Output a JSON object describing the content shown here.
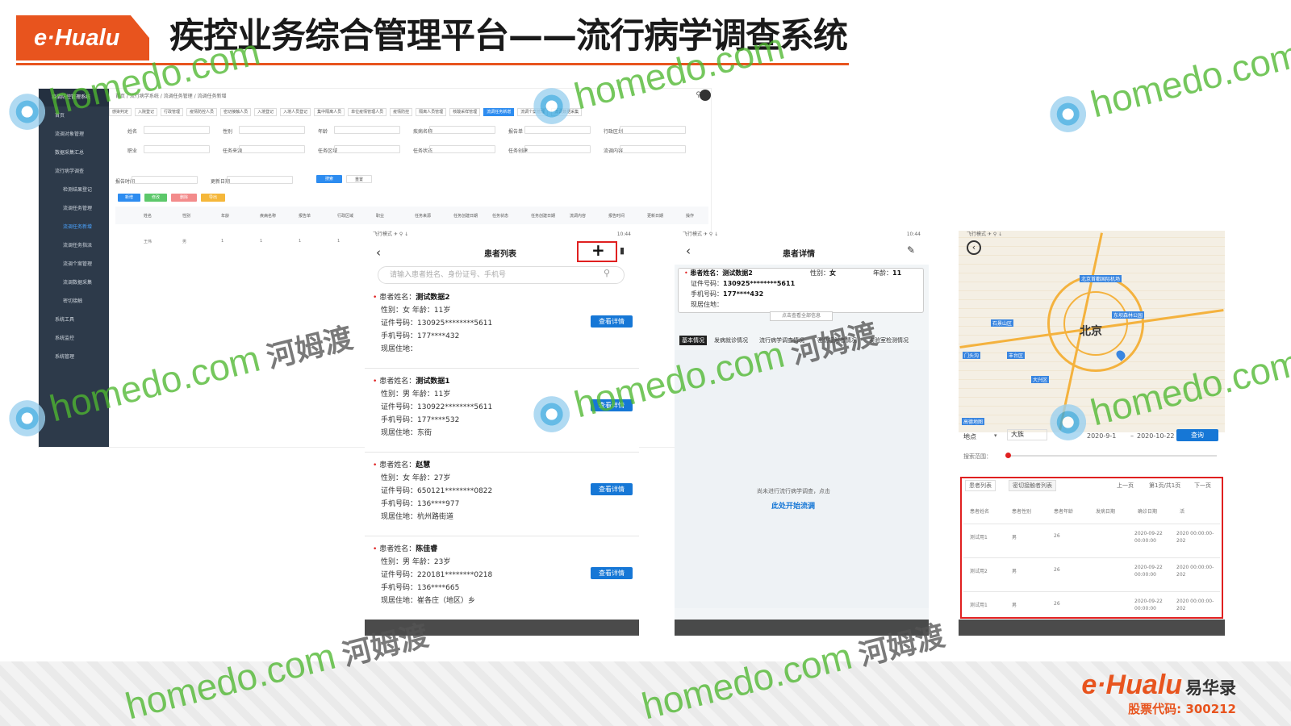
{
  "header": {
    "logo": "e·Hualu",
    "title": "疾控业务综合管理平台——流行病学调查系统"
  },
  "footer": {
    "brand": "e·Hualu",
    "brand_cn": "易华录",
    "stock": "股票代码: 300212"
  },
  "watermark": {
    "text": "homedo.com",
    "cn": "河姆渡"
  },
  "admin": {
    "brand": "疫情防控管理系统",
    "breadcrumb": "首页 / 流行病学系统 / 流调任务管理 / 流调任务新增",
    "sidebar": [
      "首页",
      "流调对象管理",
      "数据采集汇总",
      "流行病学调查",
      "检测结果登记",
      "流调任务管理",
      "流调任务新增",
      "流调任务指派",
      "流调个案管理",
      "流调数据采集",
      "密切接触",
      "系统工具",
      "系统监控",
      "系统管理"
    ],
    "tabs": [
      "感染判定",
      "入院登记",
      "行政管理",
      "疫情防控人员",
      "密切接触人员",
      "入境登记",
      "入境人员登记",
      "集中隔离人员",
      "单位疫情管理人员",
      "疫情防控",
      "隔离人员管理",
      "核酸采样管理",
      "流调任务新增",
      "流调个案管理",
      "流调数据采集"
    ],
    "filters": [
      "姓名",
      "性别",
      "年龄",
      "疾病名称",
      "报告单",
      "行政区划",
      "职业",
      "任务来源",
      "任务区域",
      "任务状态",
      "任务创建",
      "流调内容",
      "报告时间",
      "更新日期"
    ],
    "buttons": {
      "search": "搜索",
      "reset": "重置",
      "add": "新增",
      "edit": "修改",
      "del": "删除",
      "export": "导出"
    },
    "table_headers": [
      "姓名",
      "性别",
      "年龄",
      "疾病名称",
      "报告单",
      "行政区域",
      "职业",
      "任务来源",
      "任务创建日期",
      "任务状态",
      "任务创建日期",
      "流调内容",
      "报告时间",
      "更新日期",
      "操作"
    ],
    "row": [
      "王伟",
      "男",
      "1",
      "1",
      "1",
      "1",
      "1"
    ]
  },
  "phone1": {
    "status": "飞行模式 ✈ ⚲ ↓",
    "time": "10:44",
    "title": "患者列表",
    "search_placeholder": "请输入患者姓名、身份证号、手机号",
    "labels": {
      "name": "患者姓名：",
      "sex": "性别：",
      "age": "年龄：",
      "id": "证件号码：",
      "phone": "手机号码：",
      "addr": "现居住地："
    },
    "detail_label": "查看详情",
    "patients": [
      {
        "name": "测试数据2",
        "sex": "女",
        "age": "11岁",
        "id": "130925********5611",
        "phone": "177****432",
        "addr": ""
      },
      {
        "name": "测试数据1",
        "sex": "男",
        "age": "11岁",
        "id": "130922********5611",
        "phone": "177****532",
        "addr": "东街"
      },
      {
        "name": "赵慧",
        "sex": "女",
        "age": "27岁",
        "id": "650121********0822",
        "phone": "136****977",
        "addr": "杭州路街道"
      },
      {
        "name": "陈佳睿",
        "sex": "男",
        "age": "23岁",
        "id": "220181********0218",
        "phone": "136****665",
        "addr": "崔各庄（地区）乡"
      }
    ]
  },
  "phone2": {
    "status": "飞行模式 ✈ ⚲ ↓",
    "time": "10:44",
    "title": "患者详情",
    "name_label": "患者姓名：",
    "name": "测试数据2",
    "sex_label": "性别：",
    "sex": "女",
    "age_label": "年龄：",
    "age": "11",
    "id_label": "证件号码：",
    "id": "130925********5611",
    "phone_label": "手机号码：",
    "phone": "177****432",
    "addr_label": "现居住地：",
    "view_all": "点击查看全部信息",
    "tabs": [
      "基本情况",
      "发病就诊情况",
      "流行病学调查情况",
      "密切接触者情况",
      "实验室检测情况"
    ],
    "empty_hint": "尚未进行流行病学调查，点击",
    "start_link": "此处开始流调",
    "page": "1"
  },
  "phone3": {
    "status": "飞行模式 ✈ ⚲ ↓",
    "city": "北京",
    "map_labels": [
      "北京首都国际机场",
      "东坝森林公园",
      "丰台区",
      "石景山区",
      "门头沟",
      "大兴区",
      "高德地图"
    ],
    "loc_label": "地点",
    "loc_value": "大族",
    "date_from": "2020-9-1",
    "date_to": "2020-10-22",
    "query": "查询",
    "range_label": "搜索范围：",
    "tabs": [
      "患者列表",
      "密切接触者列表"
    ],
    "pager": {
      "prev": "上一页",
      "info": "第1页/共1页",
      "next": "下一页"
    },
    "headers": [
      "患者姓名",
      "患者性别",
      "患者年龄",
      "发病日期",
      "确诊日期",
      "活"
    ],
    "rows": [
      [
        "测试用1",
        "男",
        "26",
        "2020-09-22 00:00:00",
        "2020 00:00:00-202"
      ],
      [
        "测试用2",
        "男",
        "26",
        "2020-09-22 00:00:00",
        "2020 00:00:00-202"
      ],
      [
        "测试用1",
        "男",
        "26",
        "2020-09-22 00:00:00",
        "2020 00:00:00-202"
      ]
    ]
  },
  "colors": {
    "accent": "#e8541e",
    "blue": "#1677d6",
    "sidebar": "#2d3a4a",
    "highlight": "#e02020"
  }
}
